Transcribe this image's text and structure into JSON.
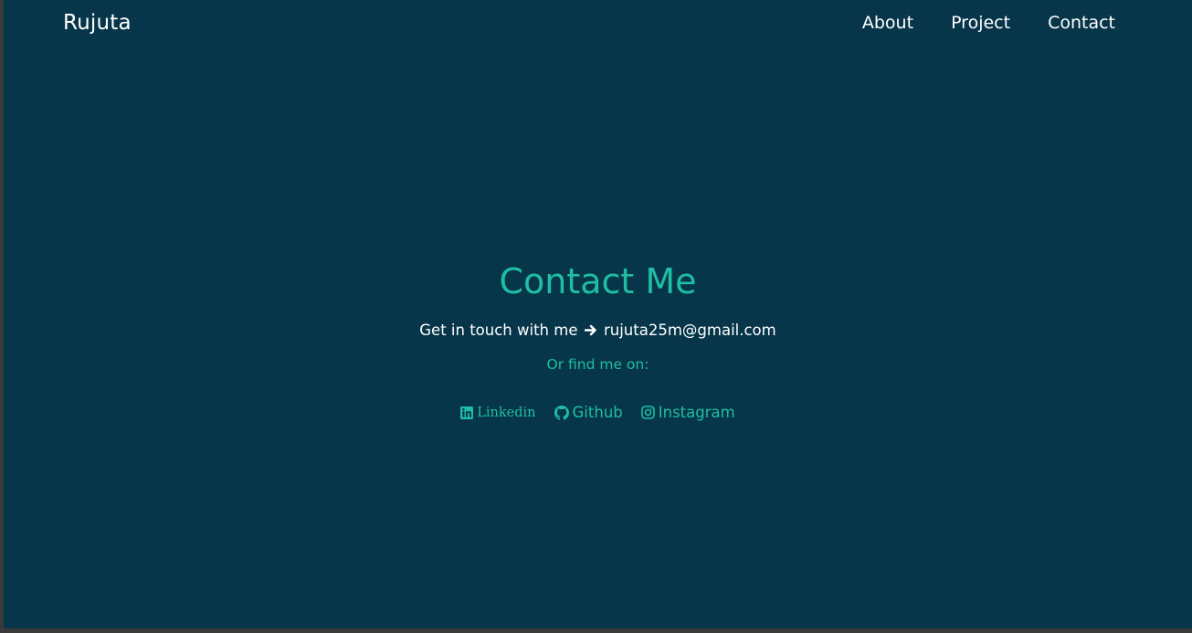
{
  "header": {
    "brand": "Rujuta",
    "nav": [
      {
        "label": "About"
      },
      {
        "label": "Project"
      },
      {
        "label": "Contact"
      }
    ]
  },
  "contact": {
    "title": "Contact Me",
    "touch_text": "Get in touch with me",
    "arrow_icon": "arrow-right-icon",
    "email": "rujuta25m@gmail.com",
    "find_text": "Or find me on:",
    "socials": [
      {
        "label": "Linkedin",
        "icon": "linkedin-icon"
      },
      {
        "label": "Github",
        "icon": "github-icon"
      },
      {
        "label": "Instagram",
        "icon": "instagram-icon"
      }
    ]
  },
  "colors": {
    "background": "#07364a",
    "accent": "#1fbea3",
    "text": "#ffffff"
  }
}
